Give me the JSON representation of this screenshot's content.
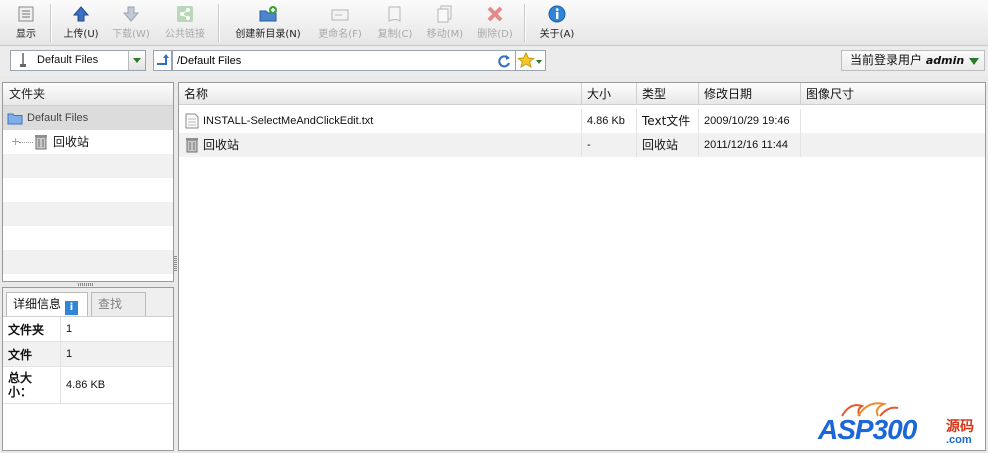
{
  "toolbar": {
    "buttons": [
      {
        "label": "显示",
        "icon": "display-icon",
        "enabled": true
      },
      {
        "label": "上传(U)",
        "icon": "upload-arrow-icon",
        "enabled": true
      },
      {
        "label": "下载(W)",
        "icon": "download-arrow-icon",
        "enabled": false
      },
      {
        "label": "公共链接",
        "icon": "share-icon",
        "enabled": false
      },
      {
        "label": "创建新目录(N)",
        "icon": "new-folder-icon",
        "enabled": true
      },
      {
        "label": "更命名(F)",
        "icon": "rename-icon",
        "enabled": false
      },
      {
        "label": "复制(C)",
        "icon": "copy-icon",
        "enabled": false
      },
      {
        "label": "移动(M)",
        "icon": "move-icon",
        "enabled": false
      },
      {
        "label": "删除(D)",
        "icon": "delete-icon",
        "enabled": false
      },
      {
        "label": "关于(A)",
        "icon": "info-icon",
        "enabled": true
      }
    ]
  },
  "address": {
    "root_select": "Default Files",
    "path": "/Default Files"
  },
  "user": {
    "prefix": "当前登录用户",
    "name": "admin"
  },
  "folder_pane": {
    "title": "文件夹",
    "tree": [
      {
        "label": "Default Files",
        "selected": true
      },
      {
        "label": "回收站",
        "selected": false
      }
    ]
  },
  "details_pane": {
    "tabs": {
      "details": "详细信息",
      "find": "查找",
      "info_badge": "i"
    },
    "rows": [
      {
        "key": "文件夹",
        "value": "1"
      },
      {
        "key": "文件",
        "value": "1"
      },
      {
        "key": "总大小：",
        "value": "4.86 KB"
      }
    ]
  },
  "files": {
    "columns": {
      "name": "名称",
      "size": "大小",
      "type": "类型",
      "modified": "修改日期",
      "dimensions": "图像尺寸"
    },
    "rows": [
      {
        "name": "INSTALL-SelectMeAndClickEdit.txt",
        "size": "4.86 Kb",
        "type": "Text文件",
        "modified": "2009/10/29 19:46",
        "icon": "text-file-icon"
      },
      {
        "name": "回收站",
        "size": "-",
        "type": "回收站",
        "modified": "2011/12/16 11:44",
        "icon": "recycle-bin-icon"
      }
    ]
  },
  "watermark": {
    "text": "ASP300",
    "cn": "源码",
    "domain": ".com"
  },
  "colors": {
    "accent_blue": "#2f86d6",
    "disabled_text": "#a9a9a9",
    "watermark_blue": "#1b66d9",
    "watermark_red": "#d4381b"
  }
}
